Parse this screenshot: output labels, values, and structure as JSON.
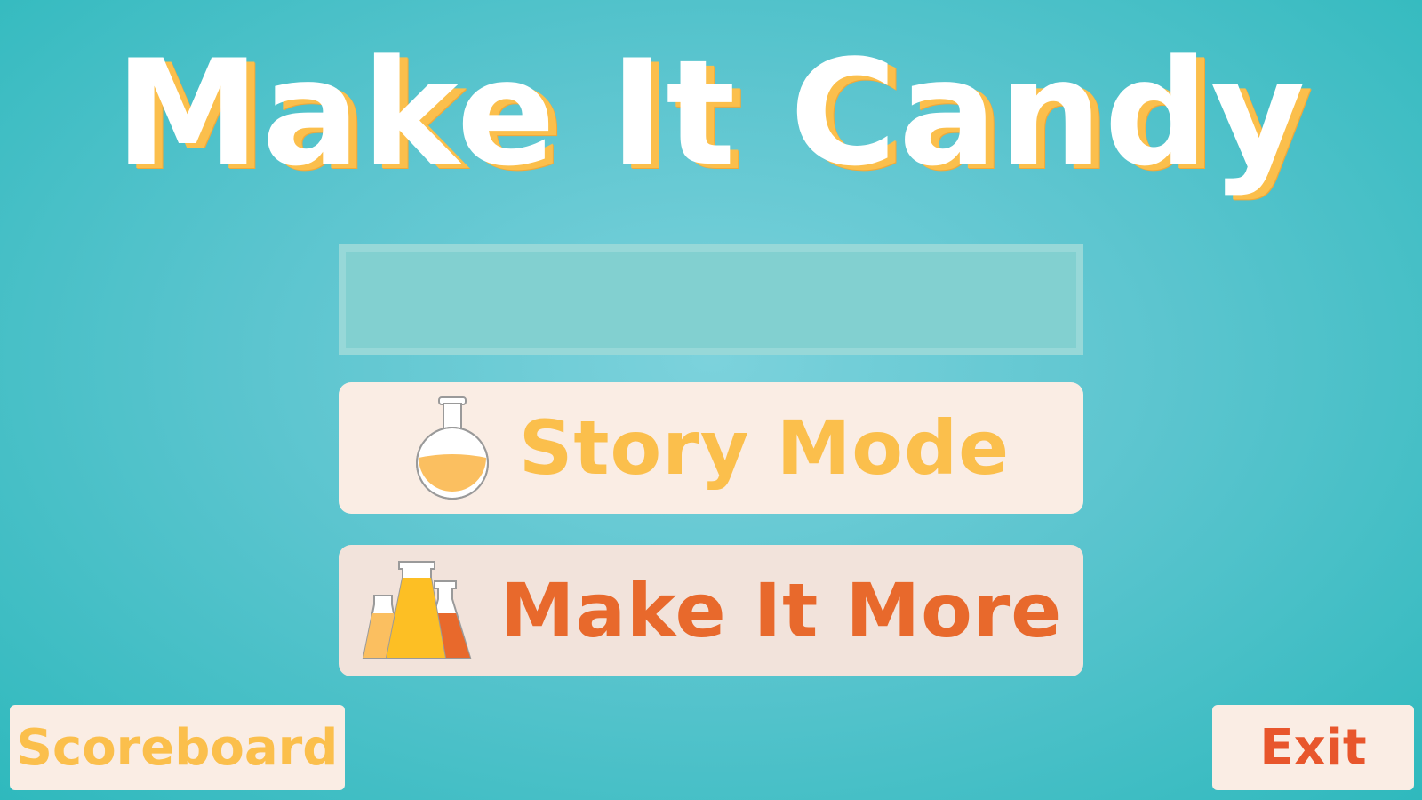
{
  "title": "Make It Candy",
  "name_input": {
    "value": "",
    "placeholder": ""
  },
  "menu": {
    "story_mode": {
      "label": "Story Mode",
      "icon": "round-flask-icon"
    },
    "make_it_more": {
      "label": "Make It More",
      "icon": "erlenmeyer-flasks-icon"
    }
  },
  "footer": {
    "scoreboard_label": "Scoreboard",
    "exit_label": "Exit"
  },
  "colors": {
    "background": "#5cc5cf",
    "title_text": "#ffffff",
    "title_shadow": "#fbbf4c",
    "button_bg": "#faede4",
    "accent_yellow": "#fbbf4c",
    "accent_orange": "#e8692c",
    "exit_red": "#e8562c"
  }
}
